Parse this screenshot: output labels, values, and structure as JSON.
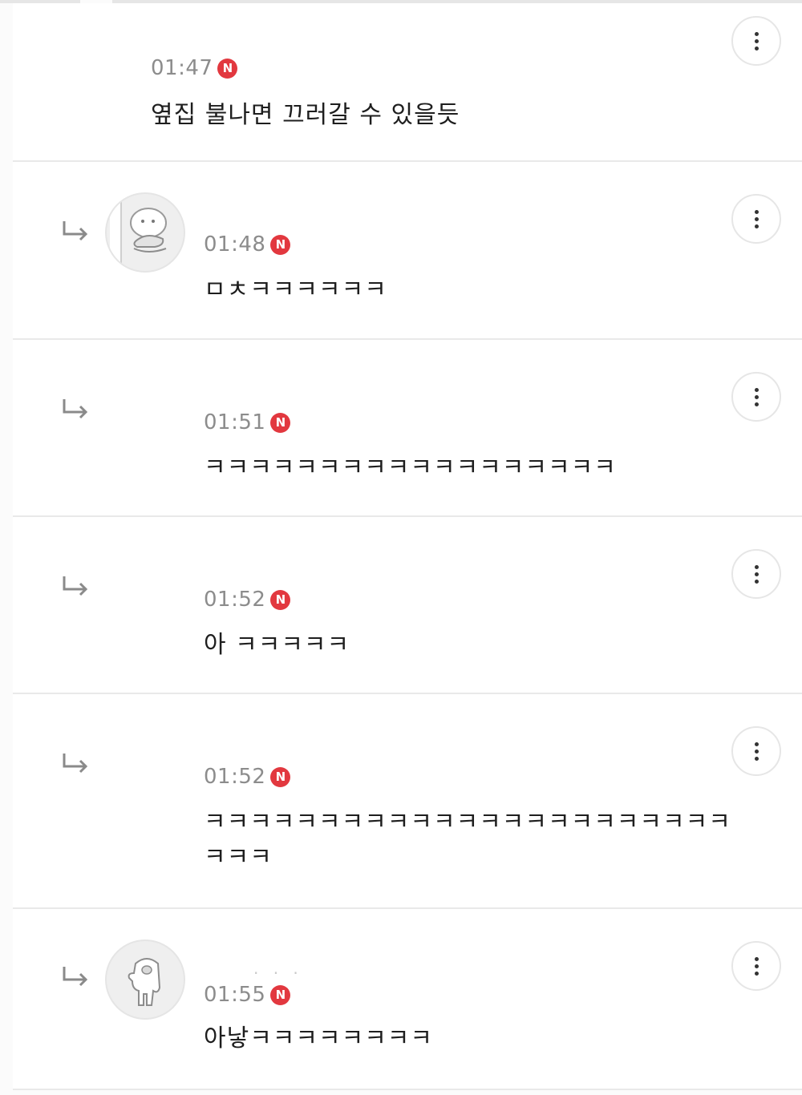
{
  "comments": [
    {
      "time": "01:47",
      "badge": "N",
      "text": "옆집 불나면 끄러갈 수 있을듯",
      "is_reply": false,
      "avatar": "none",
      "menu_icon": "more-vertical-icon"
    },
    {
      "time": "01:48",
      "badge": "N",
      "text": "ㅁㅊㅋㅋㅋㅋㅋㅋ",
      "is_reply": true,
      "avatar": "burger-character-avatar",
      "menu_icon": "more-vertical-icon"
    },
    {
      "time": "01:51",
      "badge": "N",
      "text": "ㅋㅋㅋㅋㅋㅋㅋㅋㅋㅋㅋㅋㅋㅋㅋㅋㅋㅋ",
      "is_reply": true,
      "avatar": "none",
      "menu_icon": "more-vertical-icon"
    },
    {
      "time": "01:52",
      "badge": "N",
      "text": "아 ㅋㅋㅋㅋㅋ",
      "is_reply": true,
      "avatar": "none",
      "menu_icon": "more-vertical-icon"
    },
    {
      "time": "01:52",
      "badge": "N",
      "text": "ㅋㅋㅋㅋㅋㅋㅋㅋㅋㅋㅋㅋㅋㅋㅋㅋㅋㅋㅋㅋㅋㅋㅋ\nㅋㅋㅋ",
      "is_reply": true,
      "avatar": "none",
      "menu_icon": "more-vertical-icon"
    },
    {
      "time": "01:55",
      "badge": "N",
      "text": "아낳ㅋㅋㅋㅋㅋㅋㅋㅋ",
      "is_reply": true,
      "avatar": "ghost-character-avatar",
      "menu_icon": "more-vertical-icon"
    }
  ],
  "colors": {
    "badge": "#e2383f",
    "time": "#8c8c8c",
    "text": "#1e1e1e",
    "divider": "#e9e9e9"
  }
}
